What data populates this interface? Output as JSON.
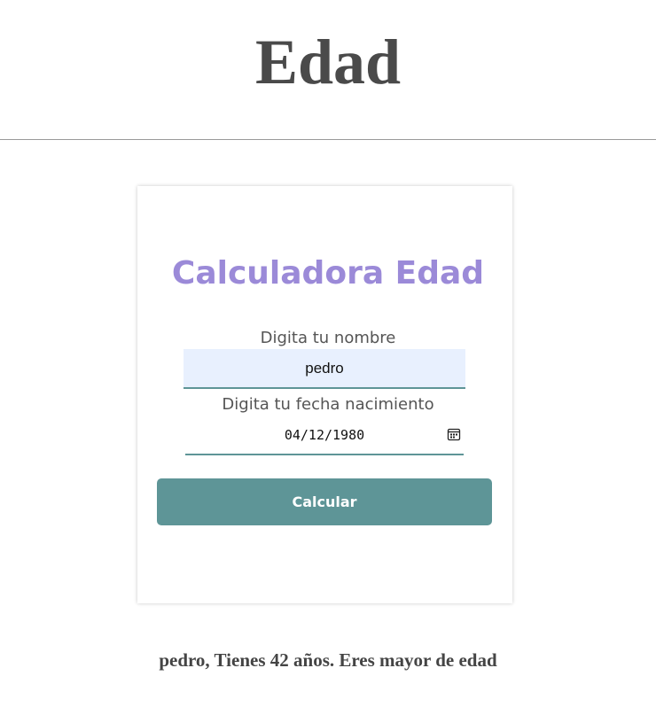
{
  "header": {
    "title": "Edad"
  },
  "form": {
    "title": "Calculadora Edad",
    "name_label": "Digita tu nombre",
    "name_value": "pedro",
    "date_label": "Digita tu fecha nacimiento",
    "date_value": "04/12/1980",
    "date_icon": "calendar-icon",
    "submit_label": "Calcular"
  },
  "result": {
    "message": "pedro, Tienes 42 años. Eres mayor de edad"
  },
  "colors": {
    "accent": "#5e9597",
    "title_purple": "#9b8ad8",
    "input_bg": "#e8f0fe"
  }
}
